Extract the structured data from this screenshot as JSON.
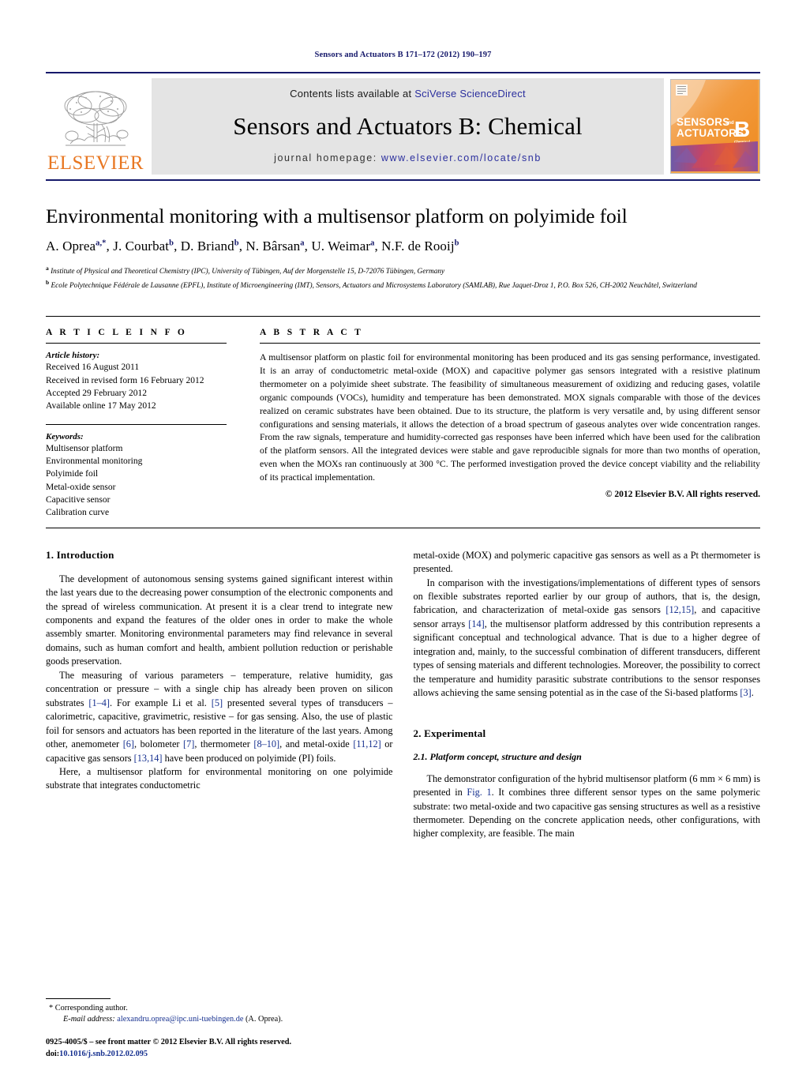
{
  "running_head": "Sensors and Actuators B 171–172 (2012) 190–197",
  "masthead": {
    "publisher_name": "ELSEVIER",
    "contents_prefix": "Contents lists available at ",
    "contents_link": "SciVerse ScienceDirect",
    "journal_title": "Sensors and Actuators B: Chemical",
    "homepage_prefix": "journal homepage: ",
    "homepage_url": "www.elsevier.com/locate/snb",
    "cover": {
      "line1": "SENSORS",
      "line1_suffix": "and",
      "line2": "ACTUATORS",
      "letter": "B",
      "letter_sub": "Chemical"
    },
    "accent_orange": "#e87722",
    "accent_blue": "#2b2f9e",
    "strip_gray": "#e4e4e4"
  },
  "title": "Environmental monitoring with a multisensor platform on polyimide foil",
  "authors_html": "A. Oprea<sup>a,*</sup>, J. Courbat<sup>b</sup>, D. Briand<sup>b</sup>, N. Bârsan<sup>a</sup>, U. Weimar<sup>a</sup>, N.F. de Rooij<sup>b</sup>",
  "affiliations": [
    "Institute of Physical and Theoretical Chemistry (IPC), University of Tübingen, Auf der Morgenstelle 15, D-72076 Tübingen, Germany",
    "Ecole Polytechnique Fédérale de Lausanne (EPFL), Institute of Microengineering (IMT), Sensors, Actuators and Microsystems Laboratory (SAMLAB), Rue Jaquet-Droz 1, P.O. Box 526, CH-2002 Neuchâtel, Switzerland"
  ],
  "article_info": {
    "heading": "A R T I C L E   I N F O",
    "history_label": "Article history:",
    "history": [
      "Received 16 August 2011",
      "Received in revised form 16 February 2012",
      "Accepted 29 February 2012",
      "Available online 17 May 2012"
    ],
    "keywords_label": "Keywords:",
    "keywords": [
      "Multisensor platform",
      "Environmental monitoring",
      "Polyimide foil",
      "Metal-oxide sensor",
      "Capacitive sensor",
      "Calibration curve"
    ]
  },
  "abstract": {
    "heading": "A B S T R A C T",
    "text": "A multisensor platform on plastic foil for environmental monitoring has been produced and its gas sensing performance, investigated. It is an array of conductometric metal-oxide (MOX) and capacitive polymer gas sensors integrated with a resistive platinum thermometer on a polyimide sheet substrate. The feasibility of simultaneous measurement of oxidizing and reducing gases, volatile organic compounds (VOCs), humidity and temperature has been demonstrated. MOX signals comparable with those of the devices realized on ceramic substrates have been obtained. Due to its structure, the platform is very versatile and, by using different sensor configurations and sensing materials, it allows the detection of a broad spectrum of gaseous analytes over wide concentration ranges. From the raw signals, temperature and humidity-corrected gas responses have been inferred which have been used for the calibration of the platform sensors. All the integrated devices were stable and gave reproducible signals for more than two months of operation, even when the MOXs ran continuously at 300 °C. The performed investigation proved the device concept viability and the reliability of its practical implementation.",
    "copyright": "© 2012 Elsevier B.V. All rights reserved."
  },
  "sections": {
    "introduction_heading": "1.  Introduction",
    "experimental_heading": "2.  Experimental",
    "subsection_heading": "2.1.  Platform concept, structure and design"
  },
  "body": {
    "left_p1": "The development of autonomous sensing systems gained significant interest within the last years due to the decreasing power consumption of the electronic components and the spread of wireless communication. At present it is a clear trend to integrate new components and expand the features of the older ones in order to make the whole assembly smarter. Monitoring environmental parameters may find relevance in several domains, such as human comfort and health, ambient pollution reduction or perishable goods preservation.",
    "left_p2_a": "The measuring of various parameters – temperature, relative humidity, gas concentration or pressure – with a single chip has already been proven on silicon substrates ",
    "left_p2_r1": "[1–4]",
    "left_p2_b": ". For example Li et al. ",
    "left_p2_r2": "[5]",
    "left_p2_c": " presented several types of transducers – calorimetric, capacitive, gravimetric, resistive – for gas sensing. Also, the use of plastic foil for sensors and actuators has been reported in the literature of the last years. Among other, anemometer ",
    "left_p2_r3": "[6]",
    "left_p2_d": ", bolometer ",
    "left_p2_r4": "[7]",
    "left_p2_e": ", thermometer ",
    "left_p2_r5": "[8–10]",
    "left_p2_f": ", and metal-oxide ",
    "left_p2_r6": "[11,12]",
    "left_p2_g": " or capacitive gas sensors ",
    "left_p2_r7": "[13,14]",
    "left_p2_h": " have been produced on polyimide (PI) foils.",
    "left_p3": "Here, a multisensor platform for environmental monitoring on one polyimide substrate that integrates conductometric",
    "right_p1": "metal-oxide (MOX) and polymeric capacitive gas sensors as well as a Pt thermometer is presented.",
    "right_p2_a": "In comparison with the investigations/implementations of different types of sensors on flexible substrates reported earlier by our group of authors, that is, the design, fabrication, and characterization of metal-oxide gas sensors ",
    "right_p2_r1": "[12,15]",
    "right_p2_b": ", and capacitive sensor arrays ",
    "right_p2_r2": "[14]",
    "right_p2_c": ", the multisensor platform addressed by this contribution represents a significant conceptual and technological advance. That is due to a higher degree of integration and, mainly, to the successful combination of different transducers, different types of sensing materials and different technologies. Moreover, the possibility to correct the temperature and humidity parasitic substrate contributions to the sensor responses allows achieving the same sensing potential as in the case of the Si-based platforms ",
    "right_p2_r3": "[3]",
    "right_p2_d": ".",
    "right_p3_a": "The demonstrator configuration of the hybrid multisensor platform (6 mm × 6 mm) is presented in ",
    "right_p3_fig": "Fig. 1",
    "right_p3_b": ". It combines three different sensor types on the same polymeric substrate: two metal-oxide and two capacitive gas sensing structures as well as a resistive thermometer. Depending on the concrete application needs, other configurations, with higher complexity, are feasible. The main"
  },
  "footnote": {
    "star": "*",
    "corresponding": "Corresponding author.",
    "email_label": "E-mail address:",
    "email": "alexandru.oprea@ipc.uni-tuebingen.de",
    "email_suffix": " (A. Oprea)."
  },
  "imprint": {
    "line1": "0925-4005/$ – see front matter © 2012 Elsevier B.V. All rights reserved.",
    "doi_label": "doi:",
    "doi": "10.1016/j.snb.2012.02.095"
  }
}
